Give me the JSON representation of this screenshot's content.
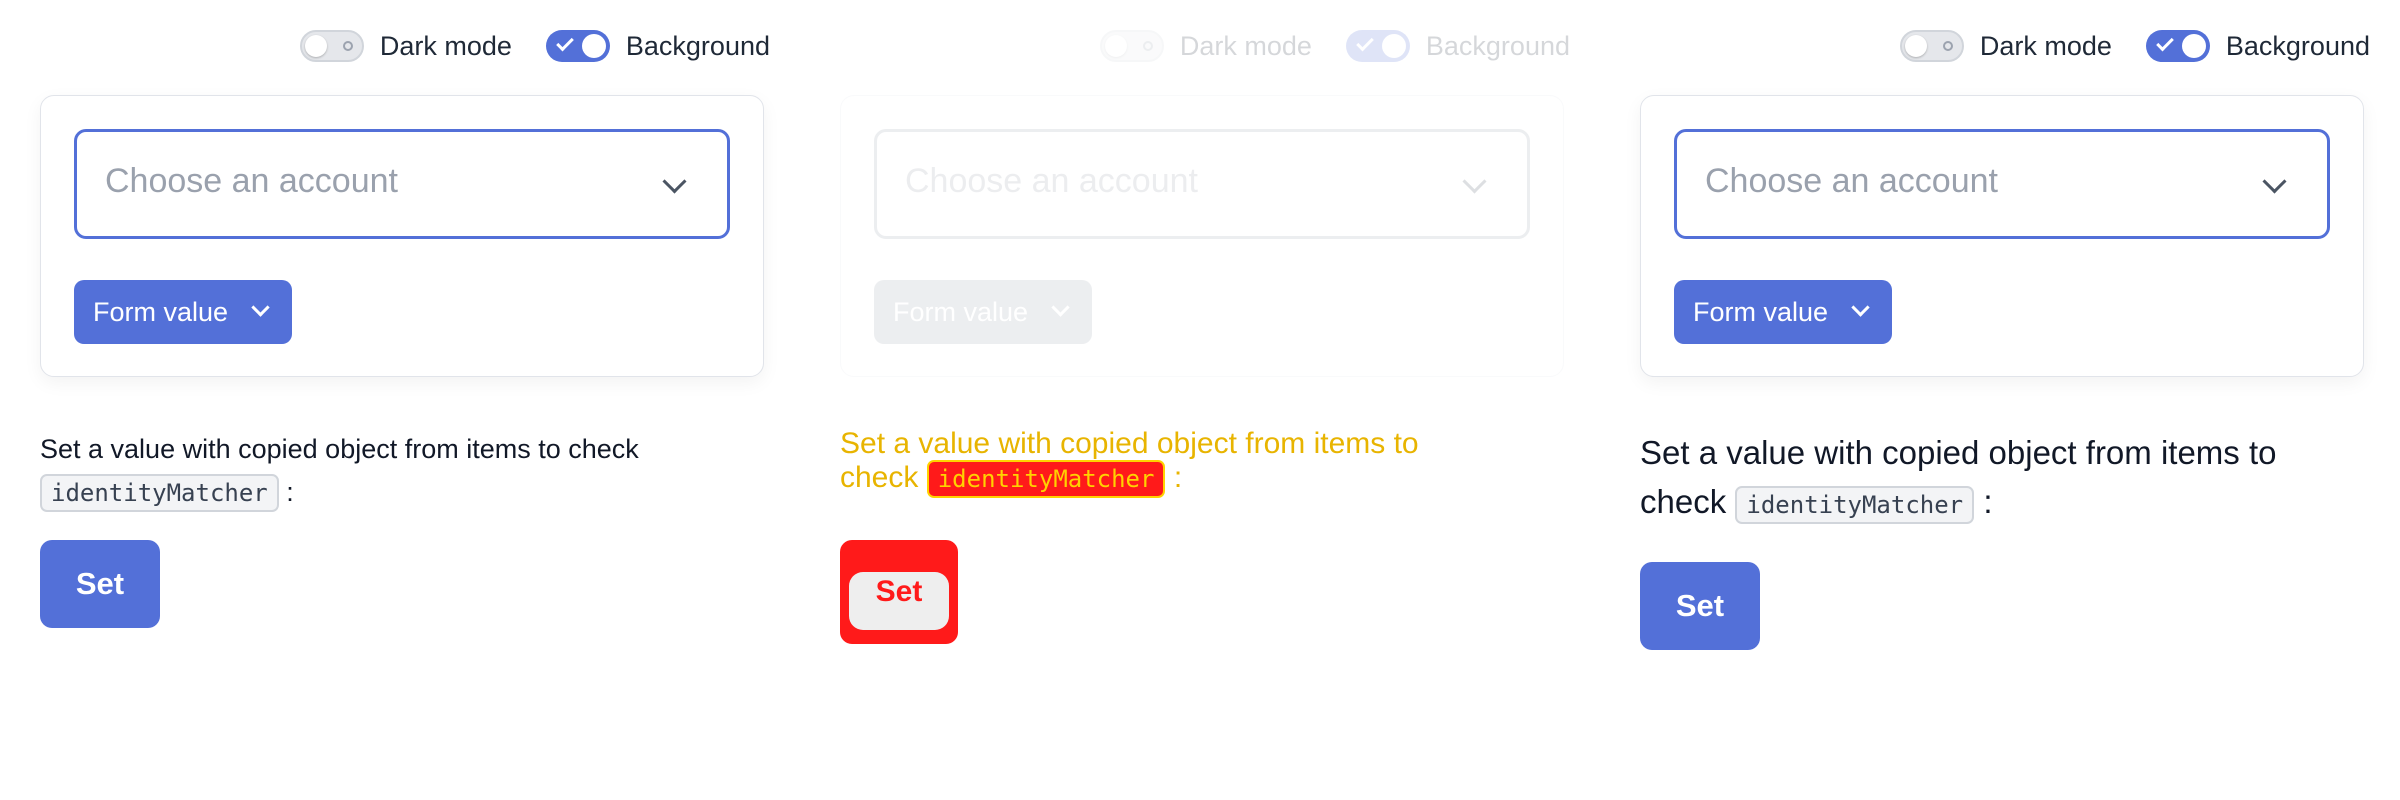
{
  "toggles": {
    "dark_mode": {
      "label": "Dark mode",
      "on": false
    },
    "background": {
      "label": "Background",
      "on": true
    }
  },
  "account_select": {
    "placeholder": "Choose an account"
  },
  "form_value_button": {
    "label": "Form value"
  },
  "description": {
    "text": "Set a value with copied object from items to check",
    "code": "identityMatcher",
    "suffix": ":"
  },
  "set_button": {
    "label": "Set"
  },
  "colors": {
    "accent": "#5370d8",
    "error_red": "#ff1a1a",
    "error_yellow": "#ffd200"
  },
  "icons": [
    "toggle-switch",
    "checkmark-icon",
    "chevron-down-icon"
  ]
}
